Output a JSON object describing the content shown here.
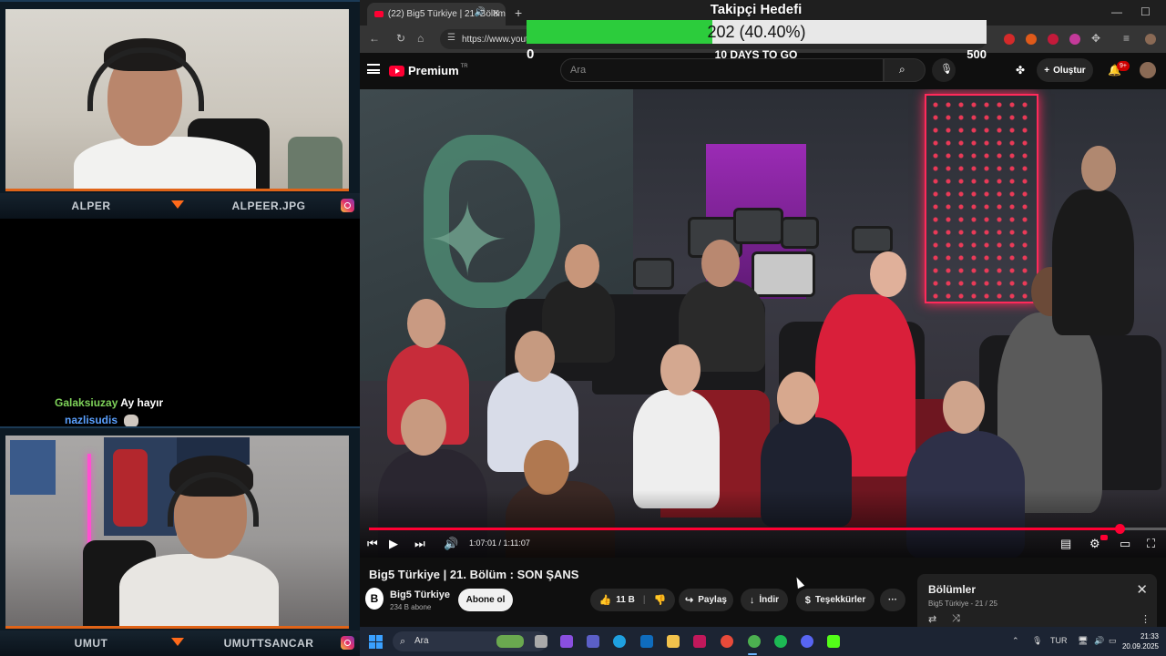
{
  "stream": {
    "cam_top": {
      "name": "ALPER",
      "handle": "ALPEER.JPG"
    },
    "cam_bottom": {
      "name": "UMUT",
      "handle": "UMUTTSANCAR"
    },
    "chat": [
      {
        "user": "Galaksiuzay",
        "message": "Ay hayır"
      },
      {
        "user": "nazlisudis",
        "message": ""
      }
    ]
  },
  "browser": {
    "tab_title": "(22) Big5 Türkiye | 21. Bölüm",
    "url": "https://www.yout"
  },
  "goal": {
    "title": "Takipçi Hedefi",
    "current": 202,
    "target": 500,
    "percent": 40.4,
    "value_text": "202 (40.40%)",
    "min_label": "0",
    "max_label": "500",
    "days_left": "10 DAYS TO GO",
    "bar_color": "#2ccc3c"
  },
  "youtube": {
    "logo": "Premium",
    "logo_region": "TR",
    "search_placeholder": "Ara",
    "create_label": "Oluştur",
    "notifications": "9+",
    "video": {
      "elapsed": "1:07:01",
      "duration": "1:11:07",
      "time_text": "1:07:01 / 1:11:07",
      "progress_fraction": 0.942,
      "title": "Big5 Türkiye | 21. Bölüm : SON ŞANS",
      "channel": "Big5 Türkiye",
      "subscribers": "234 B abone",
      "subscribe_label": "Abone ol",
      "likes": "11 B",
      "share_label": "Paylaş",
      "download_label": "İndir",
      "thanks_label": "Teşekkürler"
    },
    "episodes": {
      "title": "Bölümler",
      "subtitle": "Big5 Türkiye - 21 / 25"
    }
  },
  "taskbar": {
    "search_placeholder": "Ara",
    "language": "TUR",
    "time": "21:33",
    "date": "20.09.2025"
  }
}
